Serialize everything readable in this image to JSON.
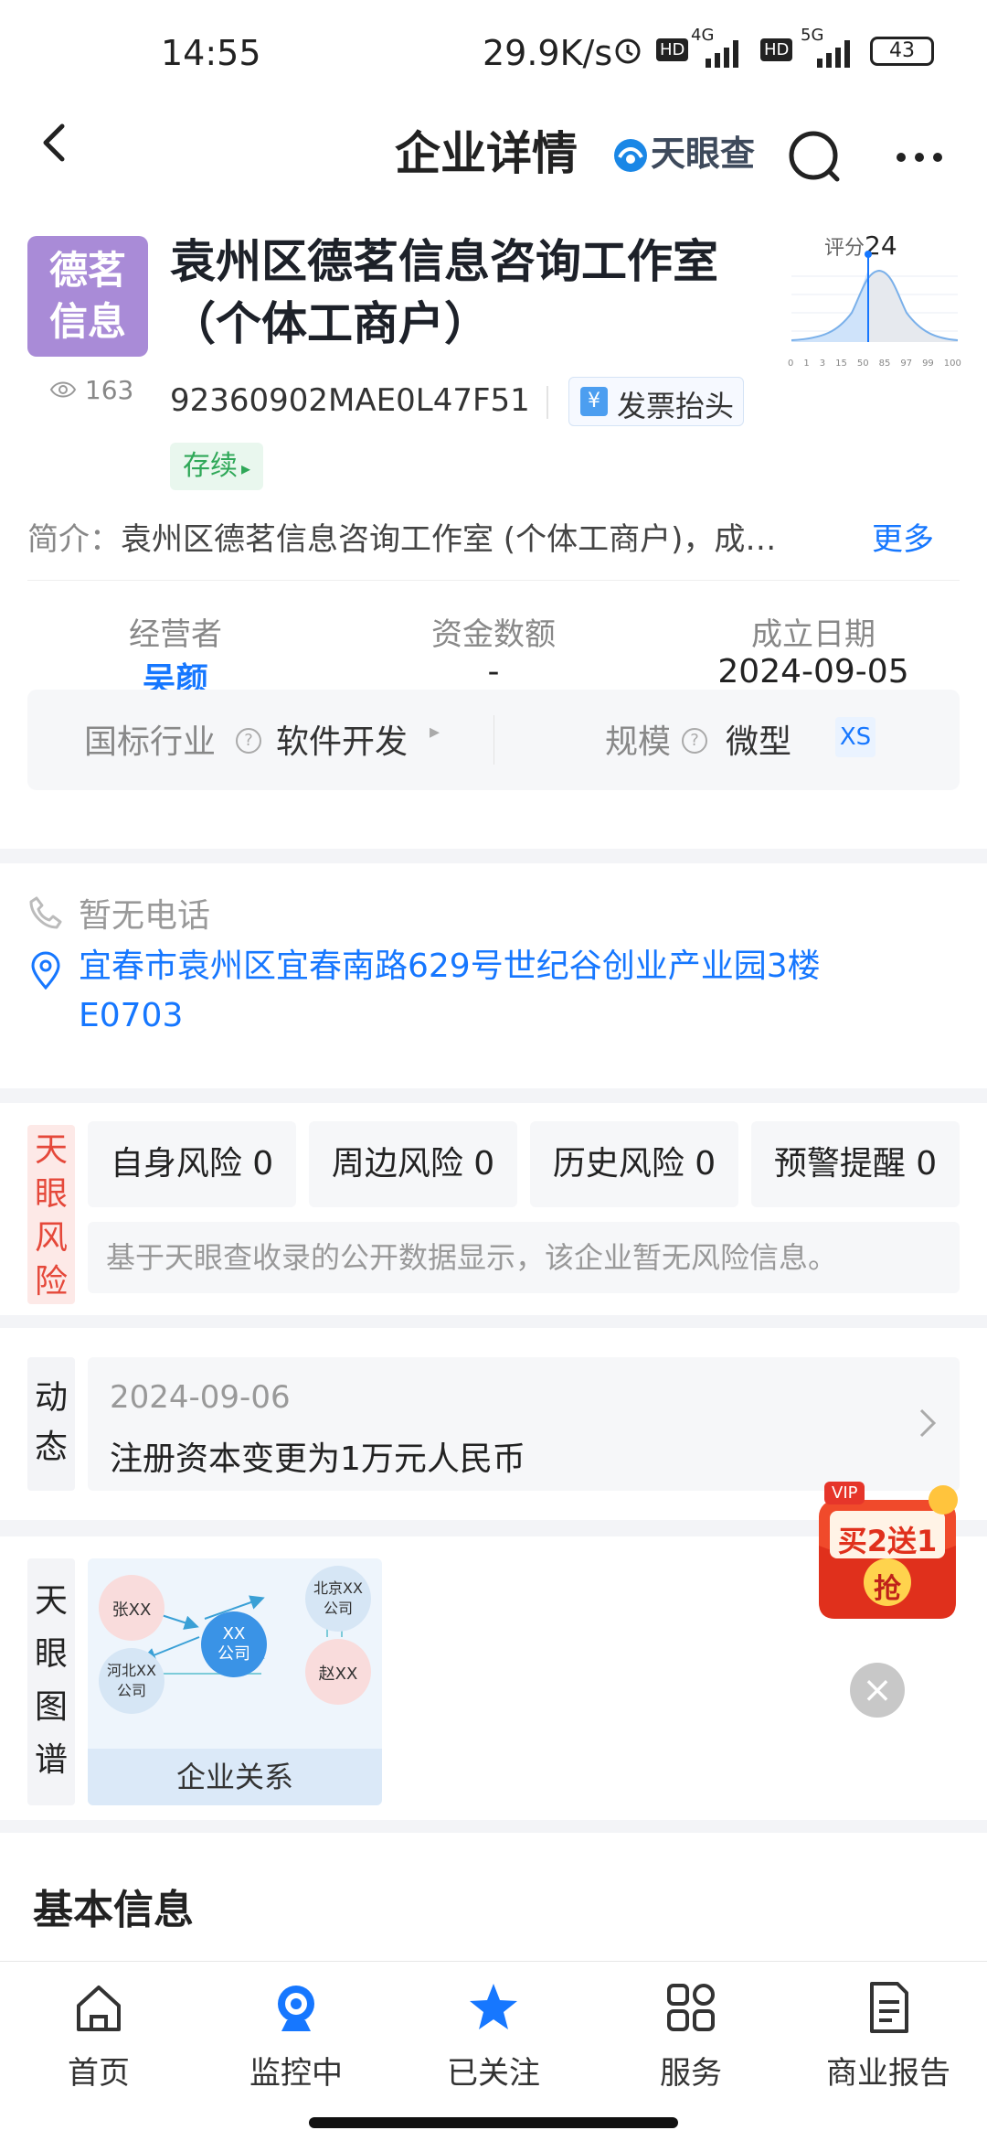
{
  "status_bar": {
    "time": "14:55",
    "net_speed": "29.9K/s",
    "signal_1": "4G",
    "signal_2": "5G",
    "hd": "HD",
    "battery": "43"
  },
  "header": {
    "title": "企业详情",
    "brand": "天眼查"
  },
  "company": {
    "logo_line1": "德茗",
    "logo_line2": "信息",
    "views": "163",
    "name": "袁州区德茗信息咨询工作室（个体工商户）",
    "credit_code": "92360902MAE0L47F51",
    "invoice_label": "发票抬头",
    "invoice_icon": "¥",
    "status": "存续",
    "score_label": "评分",
    "score": "24",
    "score_ticks": [
      "0",
      "1",
      "3",
      "15",
      "50",
      "85",
      "97",
      "99",
      "100"
    ],
    "intro_prefix": "简介：",
    "intro_text": "袁州区德茗信息咨询工作室 (个体工商户)，成…",
    "more": "更多",
    "stats": [
      {
        "label": "经营者",
        "value": "吴颜"
      },
      {
        "label": "资金数额",
        "value": "-"
      },
      {
        "label": "成立日期",
        "value": "2024-09-05"
      }
    ],
    "industry_label": "国标行业",
    "industry_value": "软件开发",
    "scale_label": "规模",
    "scale_value": "微型",
    "scale_badge": "XS"
  },
  "contact": {
    "phone": "暂无电话",
    "address": "宜春市袁州区宜春南路629号世纪谷创业产业园3楼E0703"
  },
  "risk": {
    "tag": [
      "天",
      "眼",
      "风",
      "险"
    ],
    "items": [
      {
        "label": "自身风险 0"
      },
      {
        "label": "周边风险 0"
      },
      {
        "label": "历史风险 0"
      },
      {
        "label": "预警提醒 0"
      }
    ],
    "note": "基于天眼查收录的公开数据显示，该企业暂无风险信息。"
  },
  "dynamic": {
    "tag": [
      "动",
      "态"
    ],
    "date": "2024-09-06",
    "text": "注册资本变更为1万元人民币"
  },
  "graph": {
    "tag": [
      "天",
      "眼",
      "图",
      "谱"
    ],
    "nodes": {
      "a": "张XX",
      "center_1": "XX",
      "center_2": "公司",
      "b1": "北京XX",
      "b2": "公司",
      "c1": "河北XX",
      "c2": "公司",
      "d": "赵XX"
    },
    "label": "企业关系"
  },
  "promo": {
    "vip": "VIP",
    "text": "买2送1",
    "grab": "抢"
  },
  "basic": {
    "title": "基本信息"
  },
  "nav": [
    {
      "label": "首页",
      "icon": "home-icon"
    },
    {
      "label": "监控中",
      "icon": "monitor-icon"
    },
    {
      "label": "已关注",
      "icon": "star-icon"
    },
    {
      "label": "服务",
      "icon": "grid-icon"
    },
    {
      "label": "商业报告",
      "icon": "report-icon"
    }
  ],
  "colors": {
    "accent": "#1677ff",
    "logo_bg": "#a98bd7",
    "risk_red": "#e5483a",
    "status_green": "#2fa858"
  }
}
